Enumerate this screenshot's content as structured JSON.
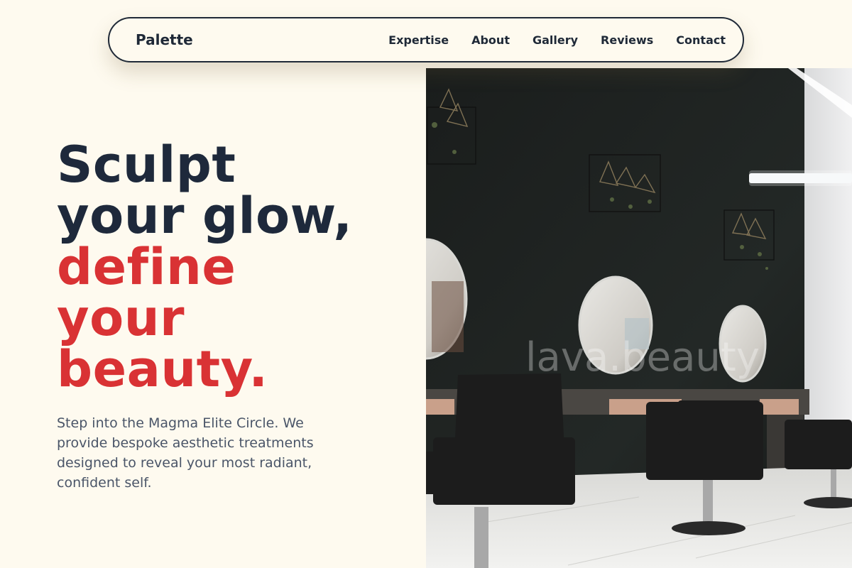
{
  "nav": {
    "brand": "Palette",
    "links": [
      "Expertise",
      "About",
      "Gallery",
      "Reviews",
      "Contact"
    ]
  },
  "hero": {
    "title_line1": "Sculpt",
    "title_line2": "your glow,",
    "title_accent_line1": "define",
    "title_accent_line2": "your",
    "title_accent_line3": "beauty.",
    "description": "Step into the Magma Elite Circle. We provide bespoke aesthetic treatments designed to reveal your most radiant, confident self.",
    "image_watermark": "lava.beauty"
  },
  "colors": {
    "background": "#fefaef",
    "navy": "#1e293b",
    "accent": "#d93234"
  }
}
